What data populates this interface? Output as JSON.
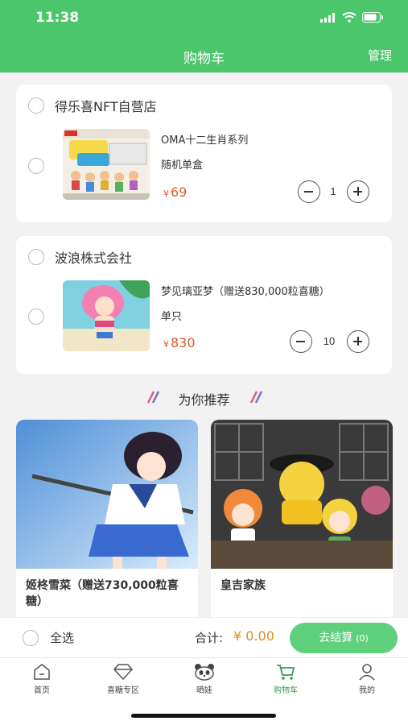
{
  "status_bar": {
    "time": "11:38"
  },
  "nav": {
    "title": "购物车",
    "manage_label": "管理"
  },
  "cart": [
    {
      "shop_name": "得乐喜NFT自营店",
      "product_title": "OMA十二生肖系列",
      "spec": "随机单盒",
      "currency": "¥",
      "price": "69",
      "quantity": "1"
    },
    {
      "shop_name": "波浪株式会社",
      "product_title": "梦见璃亚梦（赠送830,000粒喜糖）",
      "spec": "单只",
      "currency": "¥",
      "price": "830",
      "quantity": "10"
    }
  ],
  "recommend": {
    "title": "为你推荐",
    "items": [
      {
        "name": "姬柊雪菜（赠送730,000粒喜糖）"
      },
      {
        "name": "皇吉家族"
      }
    ]
  },
  "checkout": {
    "select_all_label": "全选",
    "total_label": "合计:",
    "total_value": "¥ 0.00",
    "checkout_label": "去结算",
    "checkout_count": "(0)"
  },
  "tabs": [
    {
      "label": "首页",
      "icon": "home-icon"
    },
    {
      "label": "喜糖专区",
      "icon": "diamond-icon"
    },
    {
      "label": "晒娃",
      "icon": "panda-icon"
    },
    {
      "label": "购物车",
      "icon": "cart-icon"
    },
    {
      "label": "我的",
      "icon": "user-icon"
    }
  ],
  "colors": {
    "brand_green": "#4cc66b",
    "price_red": "#e0592a",
    "total_orange": "#e08a1e",
    "checkout_button": "#5fd17d"
  }
}
